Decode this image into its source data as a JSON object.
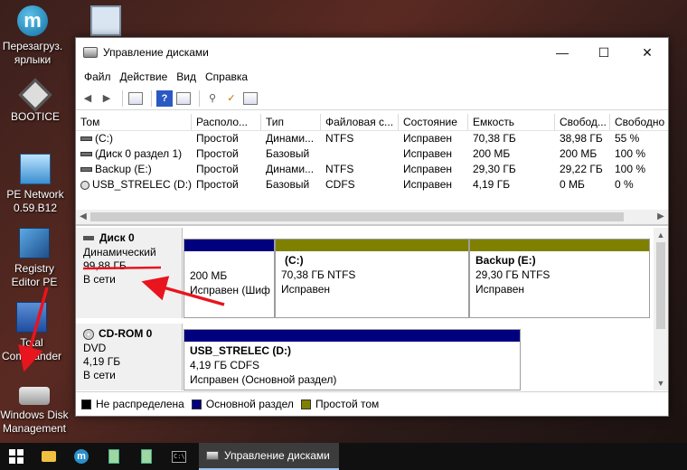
{
  "desktop": {
    "icons": [
      {
        "label_lines": [
          "Перезагруз.",
          "ярлыки"
        ],
        "icon": "m-logo-icon"
      },
      {
        "label_lines": [
          "BOOTICE"
        ],
        "icon": "bootice-icon"
      },
      {
        "label_lines": [
          "PE Network",
          "0.59.B12"
        ],
        "icon": "network-icon"
      },
      {
        "label_lines": [
          "Registry",
          "Editor PE"
        ],
        "icon": "registry-icon"
      },
      {
        "label_lines": [
          "Total",
          "Commander"
        ],
        "icon": "total-commander-icon"
      },
      {
        "label_lines": [
          "Windows Disk",
          "Management"
        ],
        "icon": "disk-management-icon"
      },
      {
        "label_lines": [
          ""
        ],
        "icon": "calculator-icon"
      }
    ]
  },
  "window": {
    "title": "Управление дисками",
    "controls": {
      "minimize": "—",
      "maximize": "☐",
      "close": "✕"
    },
    "menu": [
      "Файл",
      "Действие",
      "Вид",
      "Справка"
    ]
  },
  "volume_list": {
    "columns": [
      "Том",
      "Располо...",
      "Тип",
      "Файловая с...",
      "Состояние",
      "Емкость",
      "Свобод...",
      "Свободно"
    ],
    "rows": [
      [
        "(C:)",
        "Простой",
        "Динами...",
        "NTFS",
        "Исправен",
        "70,38 ГБ",
        "38,98 ГБ",
        "55 %"
      ],
      [
        "(Диск 0 раздел 1)",
        "Простой",
        "Базовый",
        "",
        "Исправен",
        "200 МБ",
        "200 МБ",
        "100 %"
      ],
      [
        "Backup (E:)",
        "Простой",
        "Динами...",
        "NTFS",
        "Исправен",
        "29,30 ГБ",
        "29,22 ГБ",
        "100 %"
      ],
      [
        "USB_STRELEC (D:)",
        "Простой",
        "Базовый",
        "CDFS",
        "Исправен",
        "4,19 ГБ",
        "0 МБ",
        "0 %"
      ]
    ]
  },
  "disks": [
    {
      "name": "Диск 0",
      "type": "Динамический",
      "size": "99,88 ГБ",
      "status": "В сети",
      "partitions": [
        {
          "name": "",
          "line1": "200 МБ",
          "line2": "Исправен (Шиф",
          "color": "#00007f"
        },
        {
          "name": "(C:)",
          "line1": "70,38 ГБ NTFS",
          "line2": "Исправен",
          "color": "#808000"
        },
        {
          "name": "Backup  (E:)",
          "line1": "29,30 ГБ NTFS",
          "line2": "Исправен",
          "color": "#808000"
        }
      ]
    },
    {
      "name": "CD-ROM 0",
      "type": "DVD",
      "size": "4,19 ГБ",
      "status": "В сети",
      "partitions": [
        {
          "name": "USB_STRELEC  (D:)",
          "line1": "4,19 ГБ CDFS",
          "line2": "Исправен (Основной раздел)",
          "color": "#00007f"
        }
      ]
    }
  ],
  "legend": [
    {
      "label": "Не распределена",
      "color": "#000000"
    },
    {
      "label": "Основной раздел",
      "color": "#00007f"
    },
    {
      "label": "Простой том",
      "color": "#808000"
    }
  ],
  "taskbar": {
    "active_task": "Управление дисками"
  },
  "annotation_color": "#e8141e"
}
